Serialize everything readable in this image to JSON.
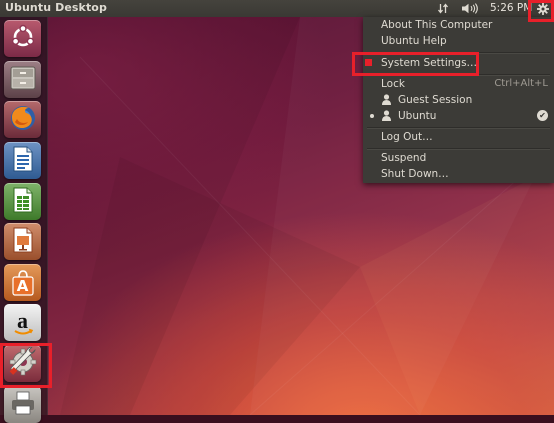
{
  "top_panel": {
    "title": "Ubuntu Desktop",
    "clock": "5:26 PM",
    "icons": [
      "network-transfer-icon",
      "volume-icon",
      "gear-icon"
    ]
  },
  "launcher": {
    "items": [
      {
        "name": "dash-home",
        "icon": "ubuntu-logo-icon"
      },
      {
        "name": "files",
        "icon": "file-cabinet-icon"
      },
      {
        "name": "firefox",
        "icon": "firefox-icon"
      },
      {
        "name": "libreoffice-writer",
        "icon": "writer-document-icon"
      },
      {
        "name": "libreoffice-calc",
        "icon": "calc-spreadsheet-icon"
      },
      {
        "name": "libreoffice-impress",
        "icon": "impress-presentation-icon"
      },
      {
        "name": "ubuntu-software-center",
        "icon": "shopping-bag-icon"
      },
      {
        "name": "amazon",
        "icon": "amazon-icon"
      },
      {
        "name": "system-settings",
        "icon": "settings-wrench-icon"
      },
      {
        "name": "printer",
        "icon": "printer-icon"
      }
    ],
    "amazon_glyph": "a",
    "software_glyph": "A"
  },
  "session_menu": {
    "items": {
      "about": "About This Computer",
      "help": "Ubuntu Help",
      "settings": "System Settings…",
      "lock": "Lock",
      "lock_accel": "Ctrl+Alt+L",
      "guest": "Guest Session",
      "user": "Ubuntu",
      "logout": "Log Out…",
      "suspend": "Suspend",
      "shutdown": "Shut Down…"
    },
    "active_user_check": "✔"
  },
  "annotations": {
    "highlight_color": "#e8202a",
    "highlighted": [
      "gear-icon",
      "system-settings-menu-item",
      "system-settings-launcher-icon"
    ]
  },
  "colors": {
    "panel_bg": "#3c3b37",
    "panel_text": "#dfdbd2",
    "wallpaper_dark": "#4e1030",
    "wallpaper_warm": "#d46a45"
  }
}
